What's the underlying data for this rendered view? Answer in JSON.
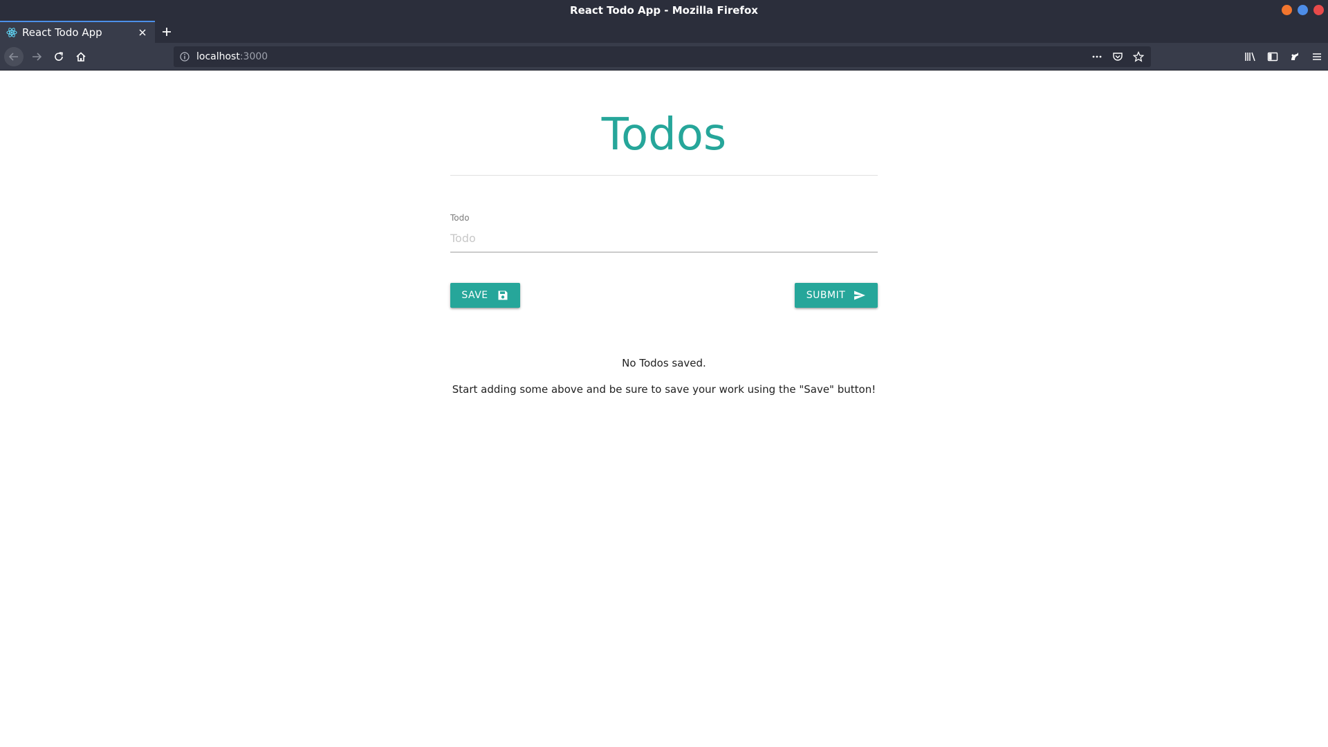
{
  "window": {
    "title": "React Todo App - Mozilla Firefox"
  },
  "tabs": [
    {
      "label": "React Todo App",
      "active": true
    }
  ],
  "nav": {
    "url_host": "localhost",
    "url_port": ":3000"
  },
  "app": {
    "heading": "Todos",
    "todo_label": "Todo",
    "todo_placeholder": "Todo",
    "todo_value": "",
    "save_label": "SAVE",
    "submit_label": "SUBMIT",
    "empty_title": "No Todos saved.",
    "empty_hint": "Start adding some above and be sure to save your work using the \"Save\" button!"
  },
  "colors": {
    "accent": "#26a69a",
    "browser_chrome": "#2b2e3b",
    "toolbar": "#383c4a"
  },
  "icons": {
    "save_icon": "floppy-disk-icon",
    "submit_icon": "send-icon"
  }
}
